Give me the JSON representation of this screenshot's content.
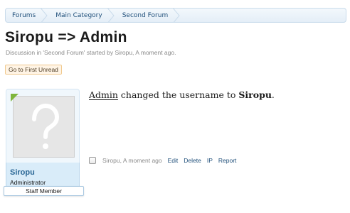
{
  "breadcrumb": {
    "items": [
      "Forums",
      "Main Category",
      "Second Forum"
    ]
  },
  "thread": {
    "title": "Siropu => Admin",
    "description": "Discussion in 'Second Forum' started by Siropu, A moment ago.",
    "unread_button": "Go to First Unread"
  },
  "post": {
    "user": {
      "name": "Siropu",
      "title": "Administrator",
      "badge": "Staff Member",
      "avatar_icon": "default-avatar-question-mark-icon",
      "online": true
    },
    "message": {
      "actor": "Admin",
      "text_middle": " changed the username to ",
      "new_name": "Siropu",
      "end": "."
    },
    "meta": {
      "author_date": "Siropu, A moment ago",
      "controls": [
        "Edit",
        "Delete",
        "IP",
        "Report"
      ]
    }
  },
  "colors": {
    "link": "#1e4e79",
    "username": "#2b6896",
    "online": "#7fb53a",
    "unread_bg": "#fff4e5"
  }
}
